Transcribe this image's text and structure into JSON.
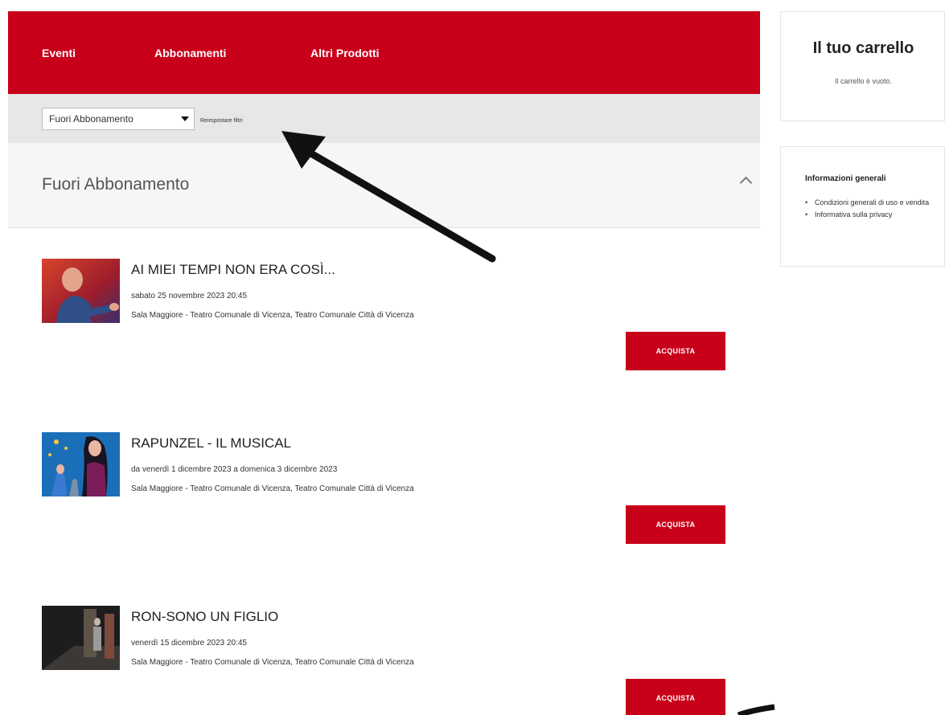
{
  "tabs": [
    {
      "label": "Eventi"
    },
    {
      "label": "Abbonamenti"
    },
    {
      "label": "Altri Prodotti"
    }
  ],
  "filter": {
    "selected": "Fuori Abbonamento",
    "reset_label": "Reimpostare filtri"
  },
  "section": {
    "title": "Fuori Abbonamento"
  },
  "events": [
    {
      "title": "AI MIEI TEMPI NON ERA COSÌ...",
      "date": "sabato 25 novembre 2023 20:45",
      "venue": "Sala Maggiore - Teatro Comunale di Vicenza, Teatro Comunale Città di Vicenza",
      "button": "ACQUISTA"
    },
    {
      "title": "RAPUNZEL - IL MUSICAL",
      "date": "da venerdì 1 dicembre 2023 a domenica 3 dicembre 2023",
      "venue": "Sala Maggiore - Teatro Comunale di Vicenza, Teatro Comunale Città di Vicenza",
      "button": "ACQUISTA"
    },
    {
      "title": "RON-SONO UN FIGLIO",
      "date": "venerdì 15 dicembre 2023 20:45",
      "venue": "Sala Maggiore - Teatro Comunale di Vicenza, Teatro Comunale Città di Vicenza",
      "button": "ACQUISTA"
    }
  ],
  "cart": {
    "title": "Il tuo carrello",
    "empty_text": "Il carrello è vuoto."
  },
  "info": {
    "title": "Informazioni generali",
    "links": [
      "Condizioni generali di uso e vendita",
      "Informativa sulla privacy"
    ]
  },
  "colors": {
    "brand_red": "#c8001a",
    "filter_bg": "#e7e7e7"
  }
}
